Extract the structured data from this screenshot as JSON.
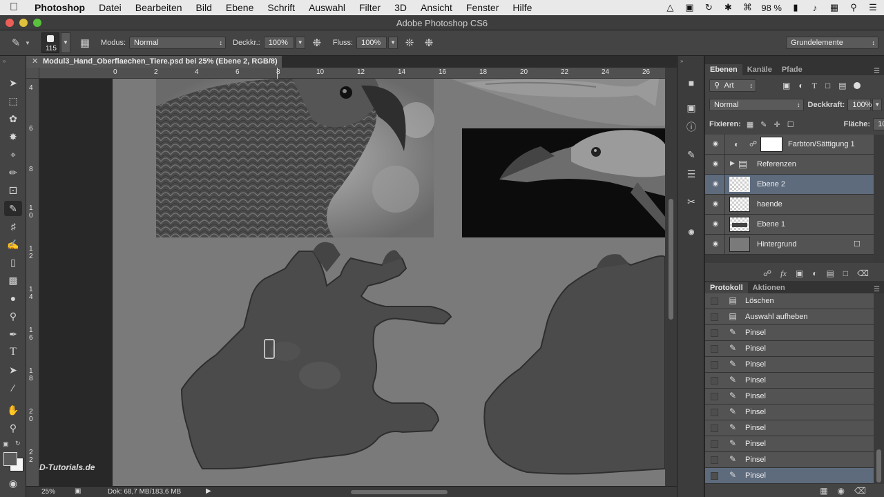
{
  "menubar": {
    "app": "Photoshop",
    "items": [
      "Datei",
      "Bearbeiten",
      "Bild",
      "Ebene",
      "Schrift",
      "Auswahl",
      "Filter",
      "3D",
      "Ansicht",
      "Fenster",
      "Hilfe"
    ],
    "battery": "98 %"
  },
  "window": {
    "title": "Adobe Photoshop CS6"
  },
  "options": {
    "brush_size": "115",
    "mode_label": "Modus:",
    "mode_value": "Normal",
    "opacity_label": "Deckkr.:",
    "opacity_value": "100%",
    "flow_label": "Fluss:",
    "flow_value": "100%",
    "workspace": "Grundelemente"
  },
  "document": {
    "tab_title": "Modul3_Hand_Oberflaechen_Tiere.psd bei 25% (Ebene 2, RGB/8) *",
    "zoom": "25%",
    "doc_size": "Dok: 68,7 MB/183,6 MB",
    "ruler_h": [
      "0",
      "2",
      "4",
      "6",
      "8",
      "10",
      "12",
      "14",
      "16",
      "18",
      "20",
      "22",
      "24",
      "26"
    ],
    "ruler_v": [
      "4",
      "6",
      "8",
      "1\n0",
      "1\n2",
      "1\n4",
      "1\n6",
      "1\n8",
      "2\n0",
      "2\n2"
    ],
    "watermark": "PSD-Tutorials.de"
  },
  "layers_panel": {
    "tabs": [
      "Ebenen",
      "Kanäle",
      "Pfade"
    ],
    "filter_label": "Art",
    "blend_mode": "Normal",
    "opacity_label": "Deckkraft:",
    "opacity_value": "100%",
    "lock_label": "Fixieren:",
    "fill_label": "Fläche:",
    "fill_value": "100%",
    "layers": [
      {
        "name": "Farbton/Sättigung 1"
      },
      {
        "name": "Referenzen"
      },
      {
        "name": "Ebene 2"
      },
      {
        "name": "haende"
      },
      {
        "name": "Ebene 1"
      },
      {
        "name": "Hintergrund"
      }
    ]
  },
  "history_panel": {
    "tabs": [
      "Protokoll",
      "Aktionen"
    ],
    "items": [
      "Löschen",
      "Auswahl aufheben",
      "Pinsel",
      "Pinsel",
      "Pinsel",
      "Pinsel",
      "Pinsel",
      "Pinsel",
      "Pinsel",
      "Pinsel",
      "Pinsel",
      "Pinsel"
    ]
  }
}
